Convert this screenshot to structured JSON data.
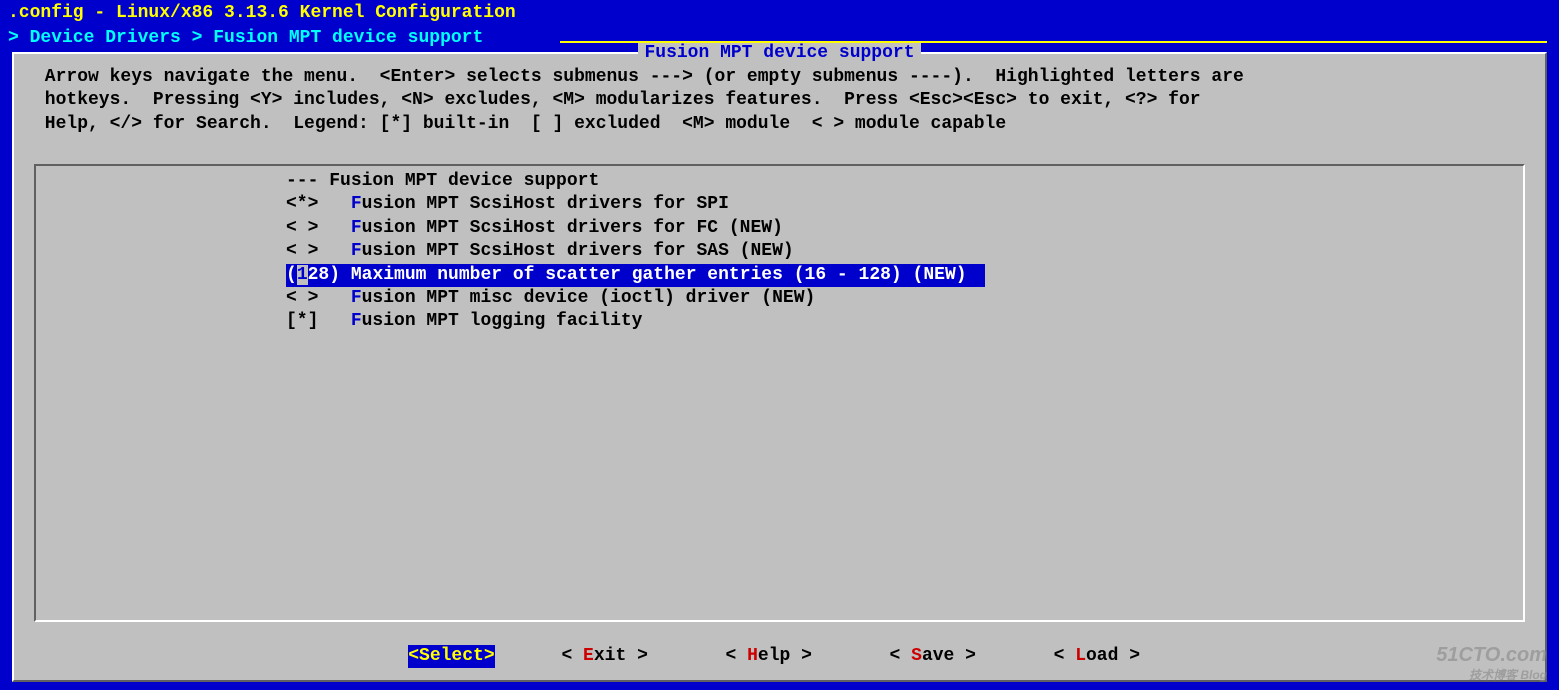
{
  "title": ".config - Linux/x86 3.13.6 Kernel Configuration",
  "breadcrumb": "> Device Drivers > Fusion MPT device support",
  "dialog_title": "Fusion MPT device support",
  "help_lines": [
    " Arrow keys navigate the menu.  <Enter> selects submenus ---> (or empty submenus ----).  Highlighted letters are",
    " hotkeys.  Pressing <Y> includes, <N> excludes, <M> modularizes features.  Press <Esc><Esc> to exit, <?> for",
    " Help, </> for Search.  Legend: [*] built-in  [ ] excluded  <M> module  < > module capable"
  ],
  "menu": [
    {
      "mark": "---",
      "hot": "",
      "label": "Fusion MPT device support",
      "selected": false
    },
    {
      "mark": "<*>  ",
      "hot": "F",
      "label": "usion MPT ScsiHost drivers for SPI",
      "selected": false
    },
    {
      "mark": "< >  ",
      "hot": "F",
      "label": "usion MPT ScsiHost drivers for FC (NEW)",
      "selected": false
    },
    {
      "mark": "< >  ",
      "hot": "F",
      "label": "usion MPT ScsiHost drivers for SAS (NEW)",
      "selected": false
    },
    {
      "mark": "(128) ",
      "hot": "",
      "label": "Maximum number of scatter gather entries (16 - 128) (NEW)",
      "selected": true,
      "input_value": "128"
    },
    {
      "mark": "< >  ",
      "hot": "F",
      "label": "usion MPT misc device (ioctl) driver (NEW)",
      "selected": false
    },
    {
      "mark": "[*]  ",
      "hot": "F",
      "label": "usion MPT logging facility",
      "selected": false
    }
  ],
  "buttons": {
    "select": {
      "pre": "<",
      "hot": "S",
      "rest": "elect>"
    },
    "exit": {
      "pre": "< ",
      "hot": "E",
      "rest": "xit > "
    },
    "help": {
      "pre": "< ",
      "hot": "H",
      "rest": "elp > "
    },
    "save": {
      "pre": "< ",
      "hot": "S",
      "rest": "ave > "
    },
    "load": {
      "pre": "< ",
      "hot": "L",
      "rest": "oad > "
    }
  },
  "watermark": {
    "main": "51CTO.com",
    "sub": "技术博客 Blog"
  }
}
